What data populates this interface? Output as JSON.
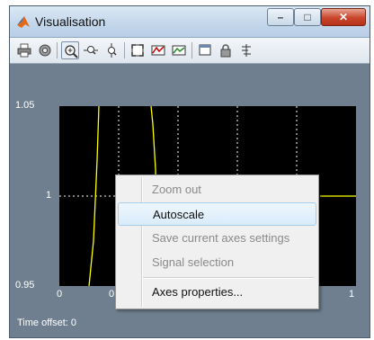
{
  "window": {
    "title": "Visualisation"
  },
  "window_buttons": {
    "minimize": "–",
    "maximize": "□",
    "close": "✕"
  },
  "toolbar": {
    "icons": [
      "print-icon",
      "settings-icon",
      "zoom-in-icon",
      "zoom-x-icon",
      "zoom-y-icon",
      "fit-to-view-icon",
      "scope-parameters-icon",
      "signal-selection-icon",
      "floating-scope-icon",
      "lock-icon",
      "signal-tools-icon"
    ]
  },
  "plot": {
    "y_ticks": [
      "1.05",
      "1",
      "0.95"
    ],
    "x_ticks": [
      "0",
      "0",
      "1"
    ],
    "time_offset_label": "Time offset:",
    "time_offset_value": "0"
  },
  "context_menu": {
    "items": [
      {
        "label": "Zoom out",
        "enabled": false
      },
      {
        "label": "Autoscale",
        "enabled": true
      },
      {
        "label": "Save current axes settings",
        "enabled": false
      },
      {
        "label": "Signal selection",
        "enabled": false
      },
      {
        "label": "Axes properties...",
        "enabled": true
      }
    ]
  },
  "colors": {
    "plot_background": "#000000",
    "signal": "#ffff00",
    "figure_background": "#6f7f8f",
    "menu_highlight": "#d9ecfb"
  }
}
